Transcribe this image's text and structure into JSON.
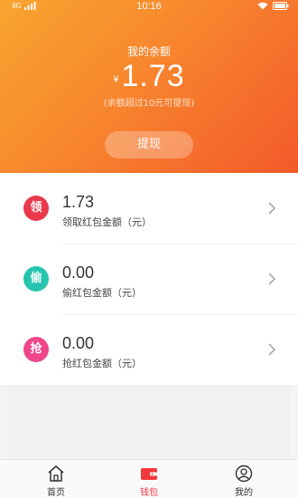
{
  "status_bar": {
    "network": "4G",
    "time": "10:16"
  },
  "balance": {
    "title": "我的余额",
    "currency": "¥",
    "amount": "1.73",
    "note": "(余额超过10元可提现)",
    "withdraw_label": "提现"
  },
  "items": [
    {
      "badge": "领",
      "amount": "1.73",
      "label": "领取红包金额（元）",
      "color": "#e83a4a"
    },
    {
      "badge": "偷",
      "amount": "0.00",
      "label": "偷红包金额（元）",
      "color": "#27c4b0"
    },
    {
      "badge": "抢",
      "amount": "0.00",
      "label": "抢红包金额（元）",
      "color": "#f0468c"
    }
  ],
  "tabs": [
    {
      "label": "首页",
      "icon": "home-icon",
      "active": false
    },
    {
      "label": "钱包",
      "icon": "wallet-icon",
      "active": true
    },
    {
      "label": "我的",
      "icon": "user-icon",
      "active": false
    }
  ],
  "colors": {
    "accent": "#f3373d",
    "hero_start": "#f8a52f",
    "hero_end": "#f2592a"
  }
}
